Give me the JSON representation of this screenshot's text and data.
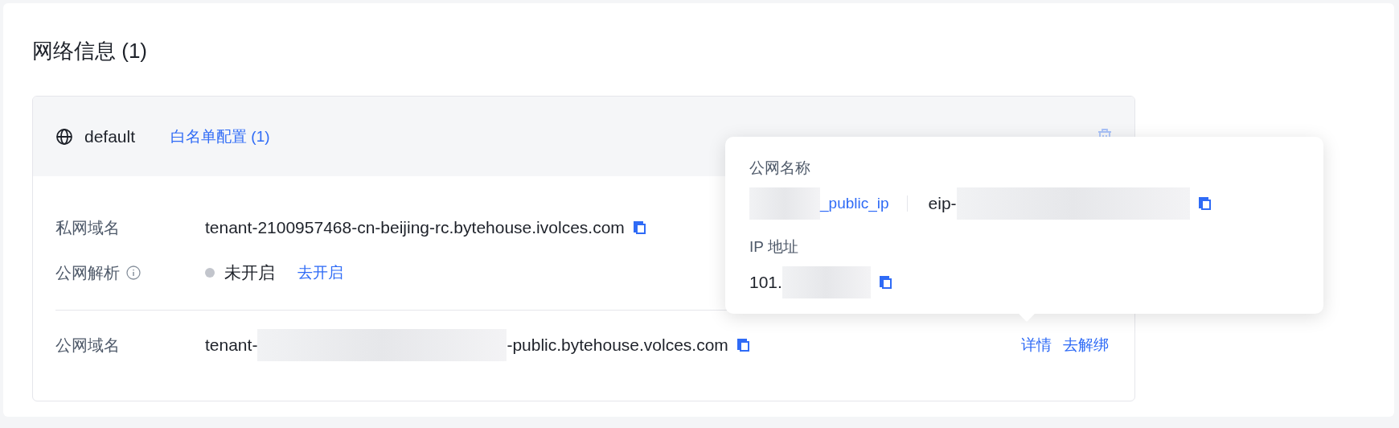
{
  "section": {
    "title": "网络信息 (1)"
  },
  "network": {
    "name": "default",
    "whitelist_link": "白名单配置 (1)",
    "rows": [
      {
        "kind": "copy",
        "label": "私网域名",
        "value": "tenant-2100957468-cn-beijing-rc.bytehouse.ivolces.com"
      },
      {
        "kind": "status",
        "label": "公网解析",
        "info": true,
        "enabled": false,
        "status": "未开启",
        "action": "去开启"
      },
      {
        "kind": "redacted",
        "label": "公网域名",
        "prefix": "tenant-",
        "suffix": "-public.bytehouse.volces.com",
        "actions": [
          "详情",
          "去解绑"
        ]
      }
    ]
  },
  "popover": {
    "name_label": "公网名称",
    "name_suffix": "_public_ip",
    "eip_prefix": "eip-",
    "ip_label": "IP 地址",
    "ip_prefix": "101."
  }
}
